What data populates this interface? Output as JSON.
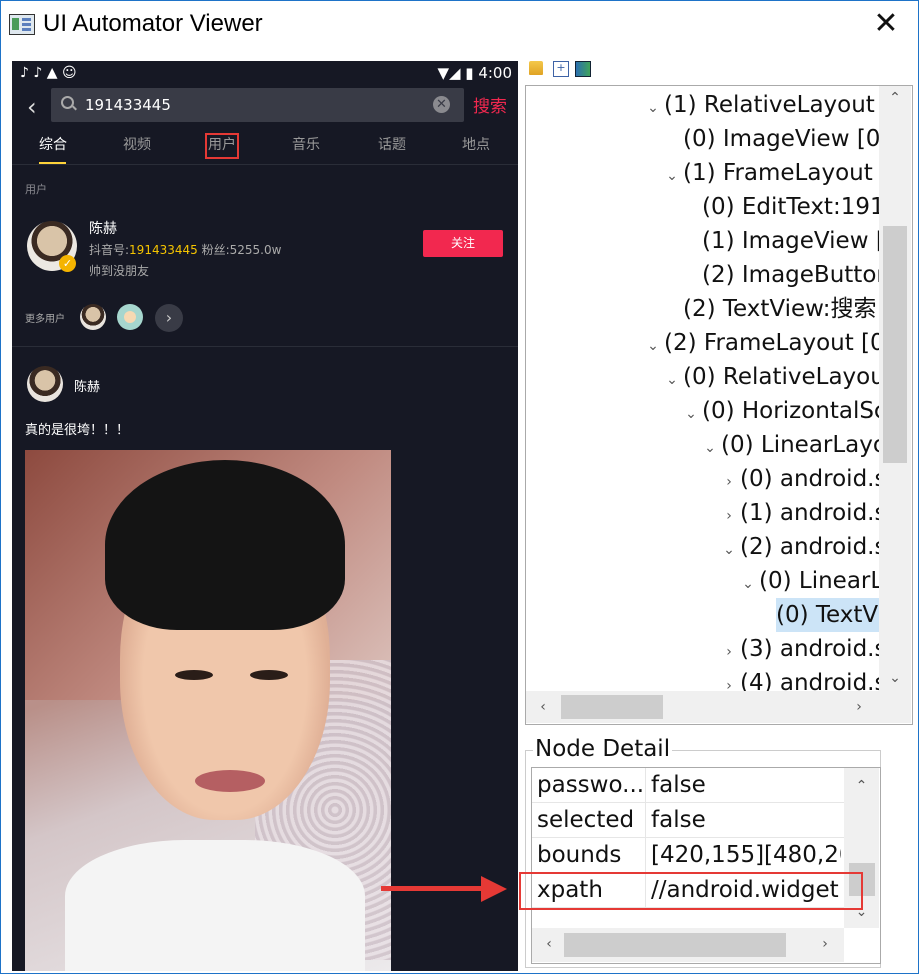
{
  "window": {
    "title": "UI Automator Viewer",
    "close_glyph": "✕"
  },
  "phone": {
    "status": {
      "left_icons": "♪ ♪ ▲ ☺",
      "right": "▼◢ ▮ 4:00"
    },
    "search": {
      "query": "191433445",
      "clear": "✕",
      "button": "搜索"
    },
    "tabs": [
      "综合",
      "视频",
      "用户",
      "音乐",
      "话题",
      "地点"
    ],
    "section_label": "用户",
    "user": {
      "name": "陈赫",
      "id_prefix": "抖音号:",
      "id": "191433445",
      "fans": " 粉丝:5255.0w",
      "bio": "帅到没朋友",
      "follow": "关注",
      "verified": "✓"
    },
    "more_users": {
      "label": "更多用户",
      "arrow": "›"
    },
    "post": {
      "name": "陈赫",
      "text": "真的是很垮！！！"
    }
  },
  "toolbar": {
    "icons": [
      "open-icon",
      "expand-icon",
      "screenshot-icon"
    ],
    "expand_glyph": "+"
  },
  "tree": {
    "rows": [
      {
        "label": "(1) RelativeLayout",
        "arrow": "⌄"
      },
      {
        "label": "(0) ImageView [0",
        "arrow": ""
      },
      {
        "label": "(1) FrameLayout",
        "arrow": "⌄"
      },
      {
        "label": "(0) EditText:191",
        "arrow": ""
      },
      {
        "label": "(1) ImageView [",
        "arrow": ""
      },
      {
        "label": "(2) ImageButton",
        "arrow": ""
      },
      {
        "label": "(2) TextView:搜索",
        "arrow": ""
      },
      {
        "label": "(2) FrameLayout [0",
        "arrow": "⌄"
      },
      {
        "label": "(0) RelativeLayou",
        "arrow": "⌄"
      },
      {
        "label": "(0) HorizontalSc",
        "arrow": "⌄"
      },
      {
        "label": "(0) LinearLayo",
        "arrow": "⌄"
      },
      {
        "label": "(0) android.s",
        "arrow": "›"
      },
      {
        "label": "(1) android.s",
        "arrow": "›"
      },
      {
        "label": "(2) android.s",
        "arrow": "⌄"
      },
      {
        "label": "(0) LinearL",
        "arrow": "⌄"
      },
      {
        "label": "(0) TextV",
        "arrow": ""
      },
      {
        "label": "(3) android.s",
        "arrow": "›"
      },
      {
        "label": "(4) android.s",
        "arrow": "›"
      }
    ],
    "scroll": {
      "up": "⌃",
      "down": "⌄",
      "left": "‹",
      "right": "›"
    }
  },
  "detail": {
    "title": "Node Detail",
    "rows": [
      {
        "key": "passwo...",
        "value": "false"
      },
      {
        "key": "selected",
        "value": "false"
      },
      {
        "key": "bounds",
        "value": "[420,155][480,20"
      },
      {
        "key": "xpath",
        "value": "//android.widget"
      }
    ],
    "scroll": {
      "up": "⌃",
      "down": "⌄",
      "left": "‹",
      "right": "›"
    }
  },
  "colors": {
    "accent": "#f2284f",
    "highlight": "#e53935",
    "phone_bg": "#161824",
    "selection": "#cce4f7"
  }
}
